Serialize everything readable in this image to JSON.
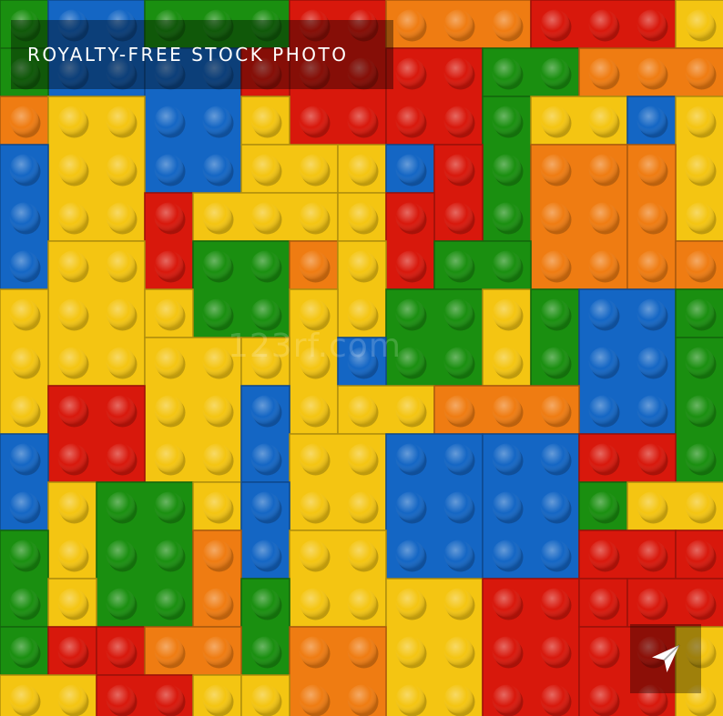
{
  "badge": {
    "text": "ROYALTY-FREE STOCK PHOTO"
  },
  "watermark": {
    "text": "123rf.com"
  },
  "share": {
    "icon": "send-icon"
  },
  "colors": {
    "yellow": "#f4c512",
    "orange": "#ef7c12",
    "red": "#d8180c",
    "green": "#1a8f10",
    "blue": "#1466c4"
  }
}
